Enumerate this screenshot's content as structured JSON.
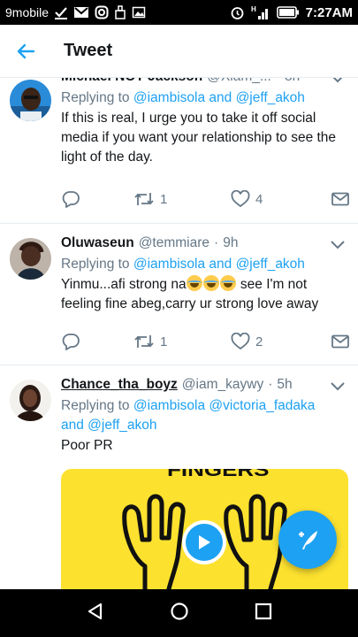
{
  "status_bar": {
    "carrier": "9mobile",
    "time": "7:27AM",
    "icons": [
      "check-icon",
      "gmail-icon",
      "instagram-icon",
      "cleaner-icon",
      "gallery-icon",
      "alarm-icon",
      "signal-h-icon",
      "battery-icon"
    ]
  },
  "app_bar": {
    "title": "Tweet",
    "back_icon": "back-arrow-icon"
  },
  "tweets": [
    {
      "name": "Michael NOT Jackson",
      "handle": "@Xlam_...",
      "separator": "·",
      "time": "8h",
      "replying_prefix": "Replying to ",
      "replying_to": [
        "@iambisola",
        "@jeff_akoh"
      ],
      "replying_joiner": " and ",
      "text": "If this is real, I urge you to take it off social media if you want your relationship to see the light of the day.",
      "retweets": "1",
      "likes": "4"
    },
    {
      "name": "Oluwaseun",
      "handle": "@temmiare",
      "separator": "·",
      "time": "9h",
      "replying_prefix": "Replying to ",
      "replying_to": [
        "@iambisola",
        "@jeff_akoh"
      ],
      "replying_joiner": " and ",
      "text_before_emoji": "Yinmu...afi strong na",
      "emoji": "😂😂😂",
      "text_after_emoji": " see I'm not feeling fine abeg,carry ur strong love away",
      "retweets": "1",
      "likes": "2"
    },
    {
      "name": "Chance_tha_boyz",
      "handle": "@iam_kaywy",
      "separator": "·",
      "time": "5h",
      "replying_prefix": "Replying to ",
      "replying_to": [
        "@iambisola",
        "@victoria_fadaka",
        "@jeff_akoh"
      ],
      "replying_joiner": " and ",
      "text": "Poor PR",
      "media_caption": "FINGERS"
    }
  ],
  "fab": {
    "icon": "compose-tweet-icon"
  },
  "nav_bar": {
    "icons": [
      "back-triangle-icon",
      "home-circle-icon",
      "recents-square-icon"
    ]
  },
  "colors": {
    "accent": "#1da1f2",
    "text": "#14171a",
    "muted": "#657786",
    "media_bg": "#fde12f"
  }
}
